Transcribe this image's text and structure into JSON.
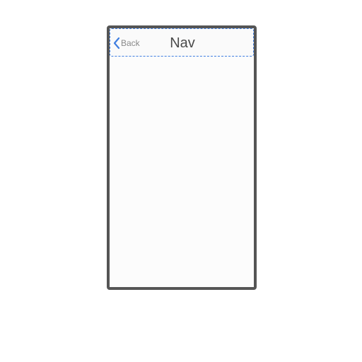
{
  "nav": {
    "back_label": "Back",
    "title": "Nav"
  },
  "icons": {
    "back": "chevron-left-icon"
  },
  "colors": {
    "accent": "#3f7ee0",
    "frame": "#555555",
    "back_text": "#8a8a8a",
    "title_text": "#4a4a4a",
    "screen_background": "#fcfcfc"
  }
}
